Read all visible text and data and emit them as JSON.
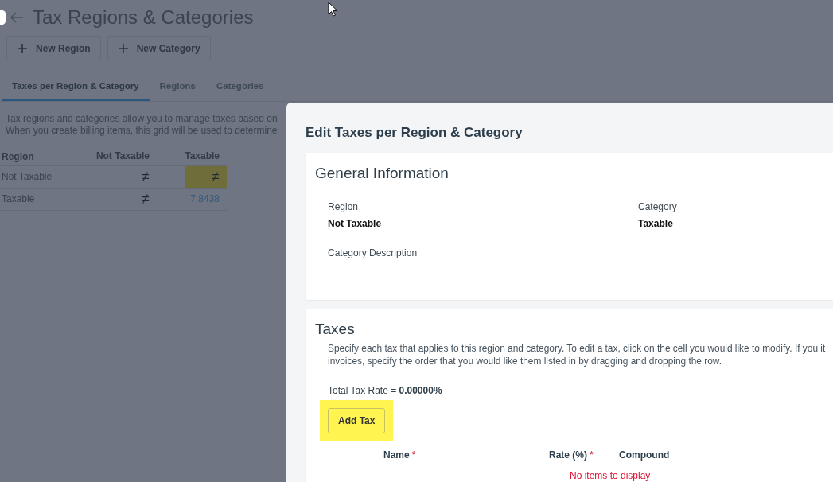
{
  "page": {
    "title": "Tax Regions & Categories",
    "buttons": [
      {
        "label": "New Region"
      },
      {
        "label": "New Category"
      }
    ],
    "tabs": [
      {
        "label": "Taxes per Region & Category",
        "selected": true
      },
      {
        "label": "Regions",
        "selected": false
      },
      {
        "label": "Categories",
        "selected": false
      }
    ],
    "description_lines": [
      "Tax regions and categories allow you to manage taxes based on",
      "When you create billing items, this grid will be used to determine"
    ],
    "grid": {
      "columns": [
        "Region",
        "Not Taxable",
        "Taxable"
      ],
      "rows": [
        {
          "cells": [
            {
              "kind": "label",
              "text": "Not Taxable",
              "highlighted": false
            },
            {
              "kind": "symbol",
              "text": "≠",
              "highlighted": false
            },
            {
              "kind": "symbol",
              "text": "≠",
              "highlighted": true
            }
          ]
        },
        {
          "cells": [
            {
              "kind": "label",
              "text": "Taxable",
              "highlighted": false
            },
            {
              "kind": "symbol",
              "text": "≠",
              "highlighted": false
            },
            {
              "kind": "number",
              "text": "7.8438",
              "highlighted": false
            }
          ]
        }
      ]
    }
  },
  "dialog": {
    "title": "Edit Taxes per Region & Category",
    "general": {
      "heading": "General Information",
      "fields": [
        {
          "label": "Region",
          "value": "Not Taxable"
        },
        {
          "label": "Category",
          "value": "Taxable"
        },
        {
          "label": "Category Description"
        }
      ]
    },
    "taxes": {
      "heading": "Taxes",
      "description_lines": [
        "Specify each tax that applies to this region and category. To edit a tax, click on the cell you would like to modify. If you it",
        "invoices, specify the order that you would like them listed in by dragging and dropping the row."
      ],
      "total": "Total Tax Rate = **0.00000%**",
      "add_button": {
        "label": "Add Tax",
        "highlighted": true
      },
      "columns": [
        {
          "label": "Name",
          "mark": "*"
        },
        {
          "label": "Rate (%)",
          "mark": "*"
        },
        {
          "label": "Compound"
        }
      ],
      "empty_message": "No items to display"
    }
  }
}
